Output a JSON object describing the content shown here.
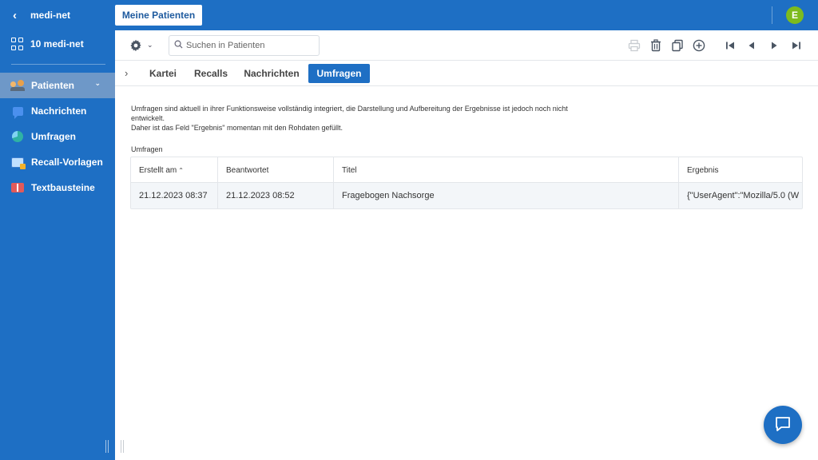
{
  "sidebar": {
    "back_label": "medi-net",
    "org_label": "10 medi-net",
    "items": [
      {
        "label": "Patienten",
        "icon": "patients-icon"
      },
      {
        "label": "Nachrichten",
        "icon": "chat-icon"
      },
      {
        "label": "Umfragen",
        "icon": "survey-icon"
      },
      {
        "label": "Recall-Vorlagen",
        "icon": "recall-template-icon"
      },
      {
        "label": "Textbausteine",
        "icon": "book-icon"
      }
    ]
  },
  "header": {
    "my_patients_label": "Meine Patienten",
    "avatar_initial": "E",
    "avatar_color": "#7dbb1e"
  },
  "toolbar": {
    "search_placeholder": "Suchen in Patienten"
  },
  "tabs": [
    {
      "label": "Kartei"
    },
    {
      "label": "Recalls"
    },
    {
      "label": "Nachrichten"
    },
    {
      "label": "Umfragen",
      "active": true
    }
  ],
  "main": {
    "note_line1": "Umfragen sind aktuell in ihrer Funktionsweise vollständig integriert, die Darstellung und Aufbereitung der Ergebnisse ist jedoch noch nicht",
    "note_line2": "entwickelt.",
    "note_line3": "Daher ist das Feld \"Ergebnis\" momentan mit den Rohdaten gefüllt.",
    "section_label": "Umfragen",
    "table": {
      "headers": [
        "Erstellt am",
        "Beantwortet",
        "Titel",
        "Ergebnis"
      ],
      "rows": [
        [
          "21.12.2023 08:37",
          "21.12.2023 08:52",
          "Fragebogen Nachsorge",
          "{\"UserAgent\":\"Mozilla/5.0 (W"
        ]
      ]
    }
  },
  "colors": {
    "brand": "#1e6fc4",
    "active_nav": "#6e98c8"
  }
}
